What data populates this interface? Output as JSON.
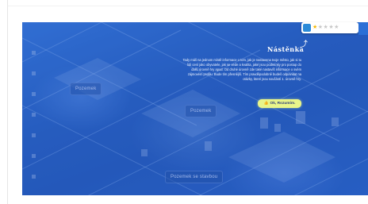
{
  "game": {
    "hud": {
      "stars_filled": "★",
      "stars_empty": "★★★★",
      "badge_icon": "profile-badge-icon"
    },
    "map_labels": [
      "Pozemek",
      "Pozemek",
      "Pozemek se stavbou"
    ],
    "bulletin": {
      "title": "Nástěnka",
      "body": "Tady máš na jednom místě informace o tom, jak je nastavena tvoje město, jak si tu lidi cení jako obyvatele, jak se vede a kvalita, jaké jsou podmínky pro postup do další úrovně hry apod. Od druhé úrovně zde také nastavíš informace o svém zájmovém profilu. Bude tím přesnější. Tím pravděpodobně budeš odpovídat na otázky, které jsou součástí 1. úrovně hry.",
      "button_label": "Ok, Rozumím.",
      "button_icon": "thumbs-up-icon"
    },
    "colors": {
      "overlay": "#2f6fcf",
      "button": "#e9f58a",
      "hud_accent": "#2b6fd6"
    }
  }
}
